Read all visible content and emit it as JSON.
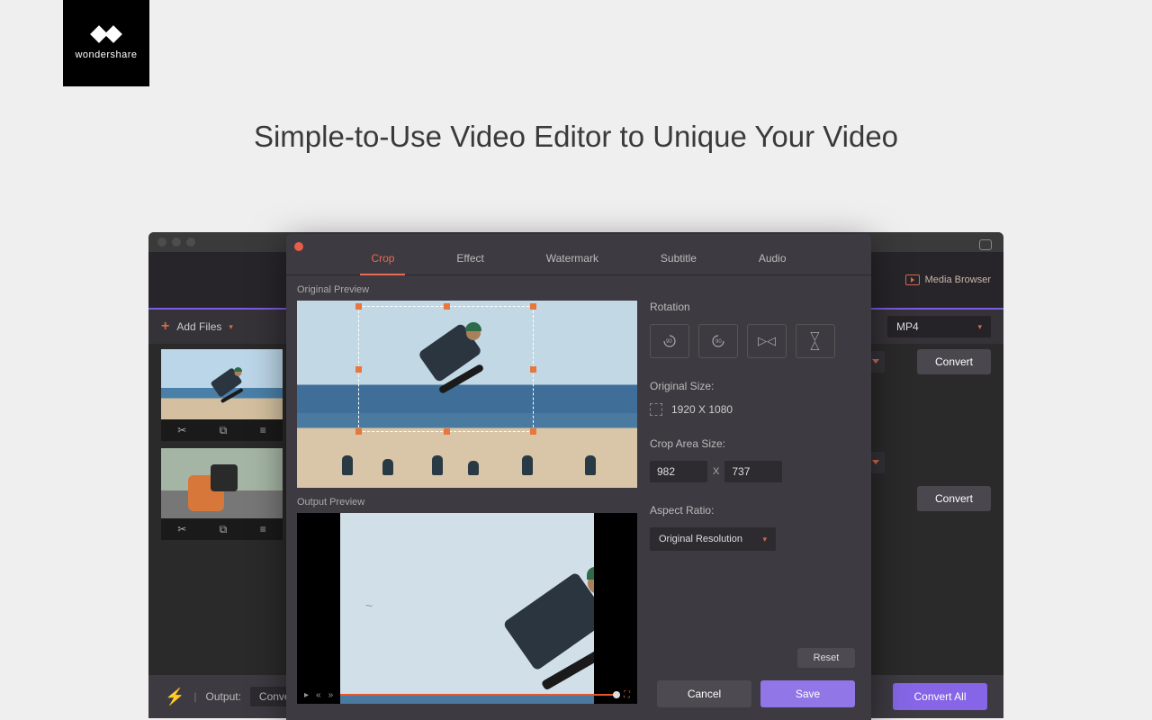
{
  "logo_text": "wondershare",
  "headline": "Simple-to-Use Video Editor to Unique Your Video",
  "app": {
    "media_browser": "Media Browser",
    "add_files": "Add Files",
    "format": "MP4",
    "convert": "Convert",
    "output_label": "Output:",
    "output_value": "Converte",
    "convert_all": "Convert All"
  },
  "editor": {
    "tabs": [
      "Crop",
      "Effect",
      "Watermark",
      "Subtitle",
      "Audio"
    ],
    "active_tab": 0,
    "original_preview": "Original Preview",
    "output_preview": "Output Preview",
    "rotation_label": "Rotation",
    "original_size_label": "Original Size:",
    "original_size_value": "1920 X 1080",
    "crop_area_label": "Crop Area Size:",
    "crop_w": "982",
    "crop_h": "737",
    "aspect_label": "Aspect Ratio:",
    "aspect_value": "Original Resolution",
    "reset": "Reset",
    "cancel": "Cancel",
    "save": "Save"
  }
}
